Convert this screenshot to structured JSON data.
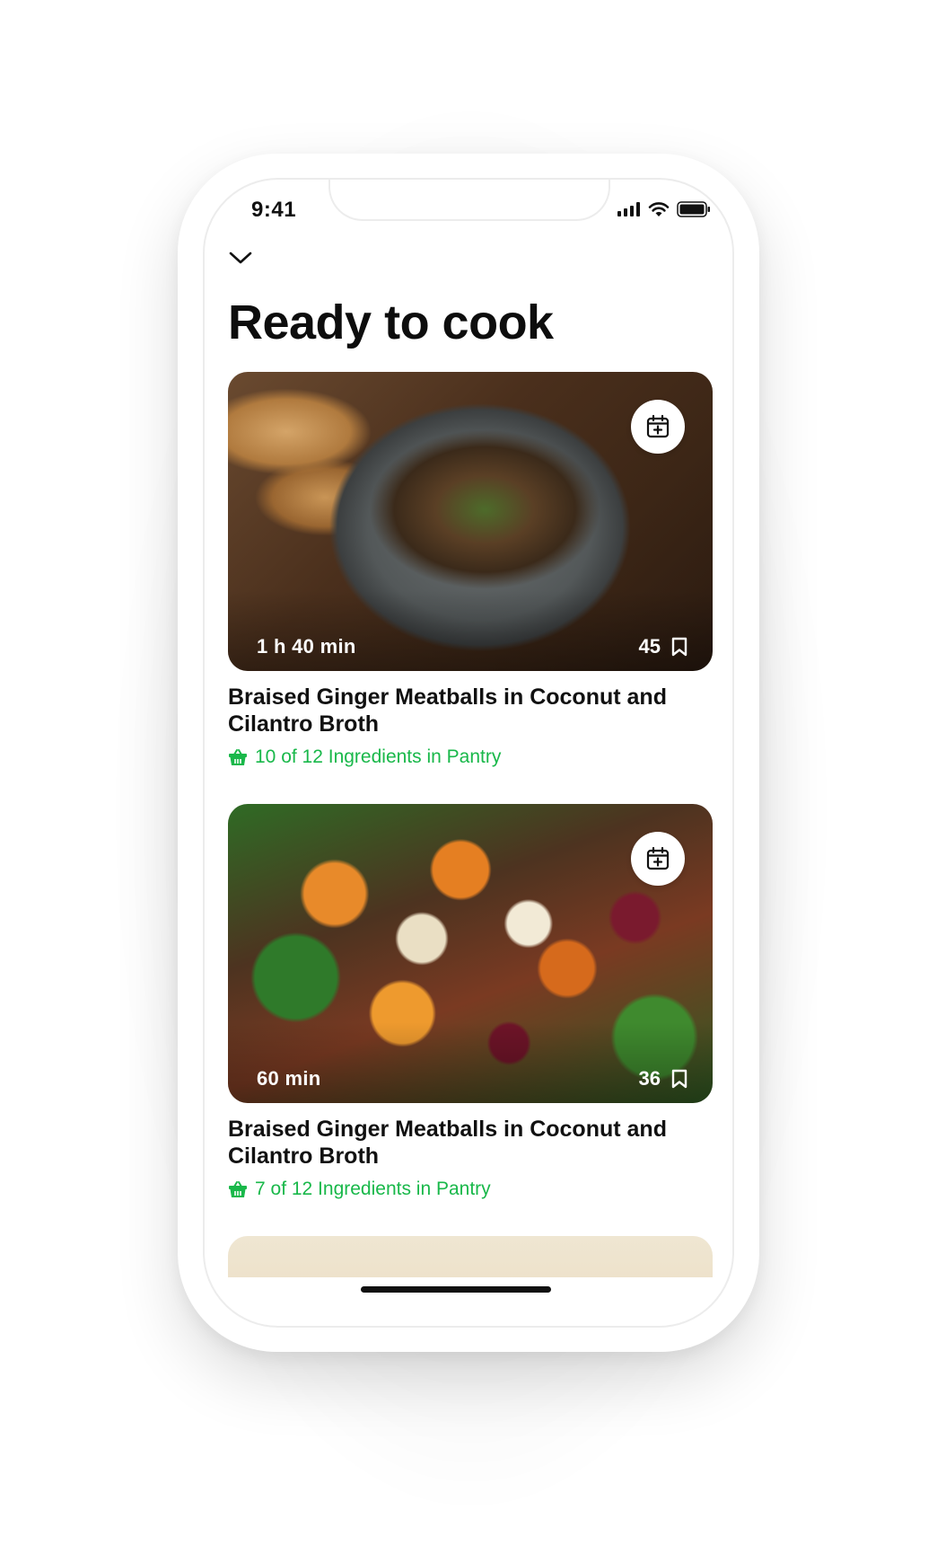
{
  "status_bar": {
    "time": "9:41"
  },
  "header": {
    "title": "Ready to cook"
  },
  "recipes": [
    {
      "duration": "1 h 40 min",
      "saves": "45",
      "title": "Braised Ginger Meatballs in Coconut and Cilantro Broth",
      "pantry": "10 of 12 Ingredients in Pantry"
    },
    {
      "duration": "60 min",
      "saves": "36",
      "title": "Braised Ginger Meatballs in Coconut and Cilantro Broth",
      "pantry": "7 of 12 Ingredients in Pantry"
    }
  ],
  "colors": {
    "accent_green": "#19b84a",
    "text_primary": "#111111"
  },
  "icons": {
    "collapse": "chevron-down-icon",
    "schedule": "calendar-add-icon",
    "bookmark": "bookmark-icon",
    "pantry": "basket-icon"
  }
}
